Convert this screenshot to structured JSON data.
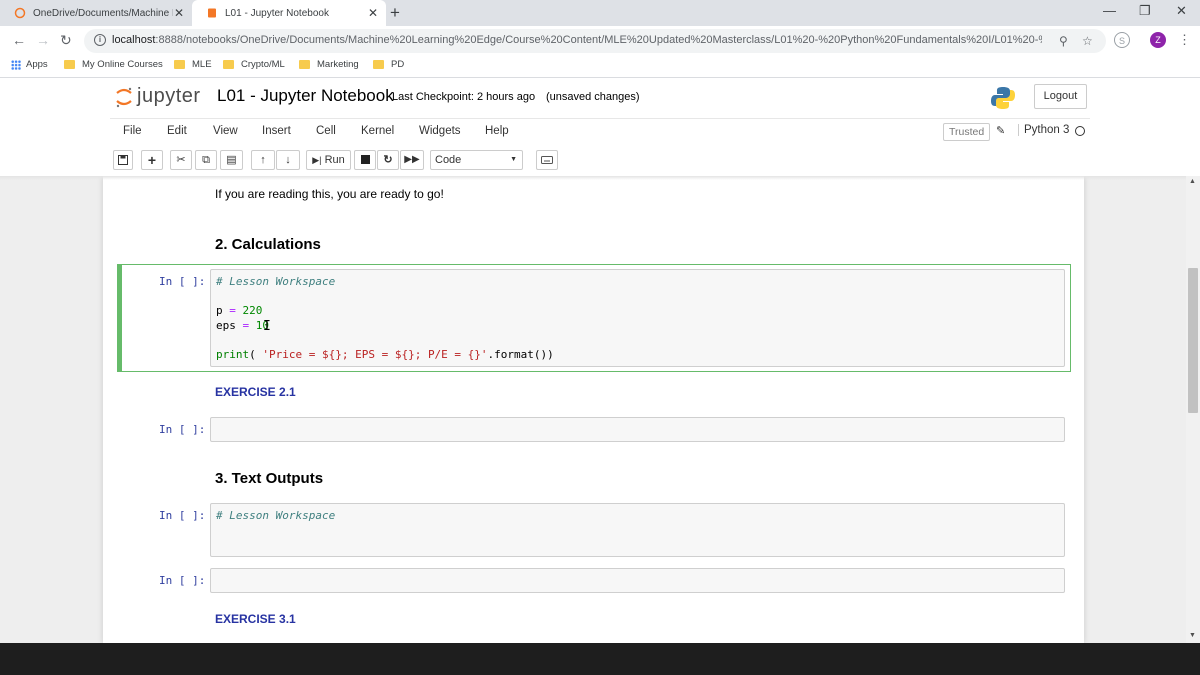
{
  "browser": {
    "tabs": [
      {
        "title": "OneDrive/Documents/Machine L",
        "close": "✕"
      },
      {
        "title": "L01 - Jupyter Notebook",
        "close": "✕"
      }
    ],
    "new_tab": "+",
    "window_controls": {
      "minimize": "—",
      "restore": "❐",
      "close": "✕"
    },
    "url_host": "localhost",
    "url_path": ":8888/notebooks/OneDrive/Documents/Machine%20Learning%20Edge/Course%20Content/MLE%20Updated%20Masterclass/L01%20-%20Python%20Fundamentals%20I/L01%20-%2...",
    "extension_letter": "Z",
    "bookmarks": [
      {
        "label": "Apps",
        "icon": "apps-grid-icon"
      },
      {
        "label": "My Online Courses",
        "icon": "folder-icon"
      },
      {
        "label": "MLE",
        "icon": "folder-icon"
      },
      {
        "label": "Crypto/ML",
        "icon": "folder-icon"
      },
      {
        "label": "Marketing",
        "icon": "folder-icon"
      },
      {
        "label": "PD",
        "icon": "folder-icon"
      }
    ]
  },
  "jupyter": {
    "brand": "jupyter",
    "notebook_name": "L01 - Jupyter Notebook",
    "checkpoint": "Last Checkpoint: 2 hours ago",
    "save_status": "(unsaved changes)",
    "logout_label": "Logout",
    "menus": [
      "File",
      "Edit",
      "View",
      "Insert",
      "Cell",
      "Kernel",
      "Widgets",
      "Help"
    ],
    "trusted_label": "Trusted",
    "kernel_name": "Python 3",
    "toolbar": {
      "run_label": "Run",
      "cell_type": "Code"
    },
    "colors": {
      "edit_border": "#66bb6a",
      "exercise": "#2733a2",
      "jupyter_orange": "#f37726"
    }
  },
  "notebook": {
    "intro_text": "If you are reading this, you are ready to go!",
    "section_2": "2. Calculations",
    "section_3": "3. Text Outputs",
    "exercise_2_1": "EXERCISE 2.1",
    "exercise_3_1": "EXERCISE 3.1",
    "prompt": "In [ ]:",
    "cell1": {
      "comment": "# Lesson Workspace",
      "line_p_var": "p",
      "line_p_val": "220",
      "line_eps_var": "eps",
      "line_eps_val": "10",
      "print_fn": "print",
      "print_open": "( ",
      "print_str": "'Price = ${}; EPS = ${}; P/E = {}'",
      "print_tail": ".format())"
    },
    "cell3": {
      "comment": "# Lesson Workspace"
    }
  }
}
